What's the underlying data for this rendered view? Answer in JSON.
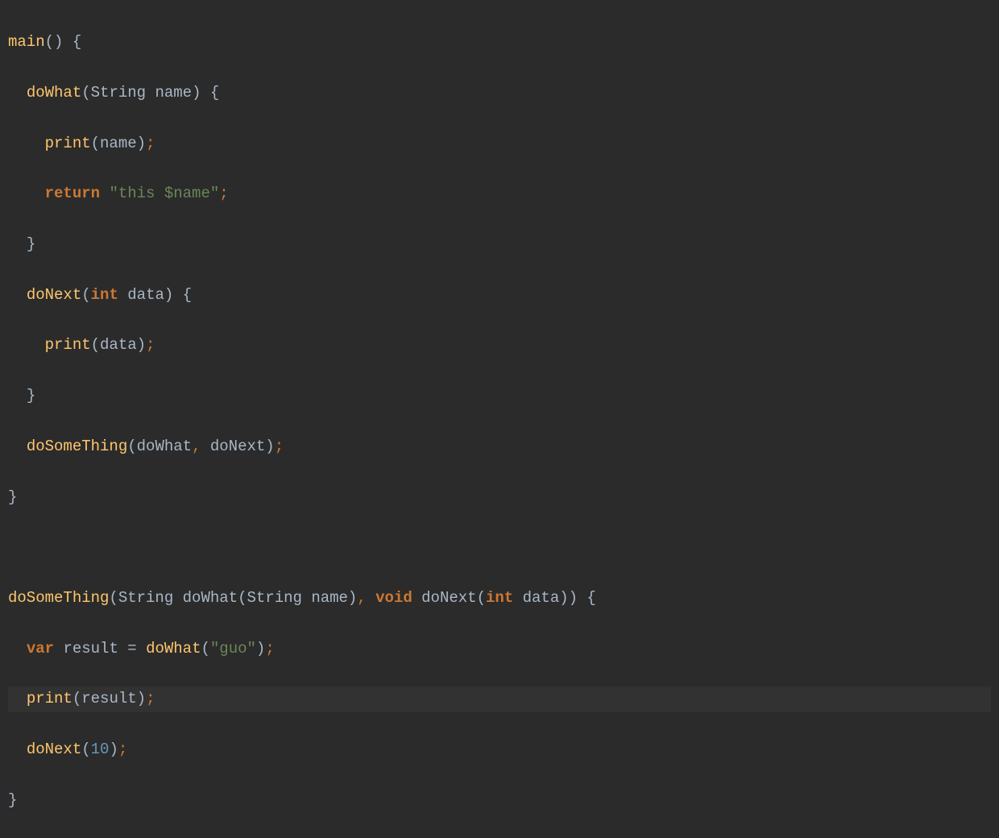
{
  "code": {
    "line1": {
      "fn": "main",
      "parens": "()",
      "brace": " {"
    },
    "line2": {
      "indent": "  ",
      "fn": "doWhat",
      "paren_open": "(",
      "type": "String",
      "space": " ",
      "param": "name",
      "paren_close": ")",
      "brace": " {"
    },
    "line3": {
      "indent": "    ",
      "fn": "print",
      "paren_open": "(",
      "arg": "name",
      "close": ")",
      "semi": ";"
    },
    "line4": {
      "indent": "    ",
      "keyword": "return",
      "space": " ",
      "string": "\"this $name\"",
      "semi": ";"
    },
    "line5": {
      "indent": "  ",
      "brace": "}"
    },
    "line6": {
      "indent": "  ",
      "fn": "doNext",
      "paren_open": "(",
      "type": "int",
      "space": " ",
      "param": "data",
      "paren_close": ")",
      "brace": " {"
    },
    "line7": {
      "indent": "    ",
      "fn": "print",
      "paren_open": "(",
      "arg": "data",
      "close": ")",
      "semi": ";"
    },
    "line8": {
      "indent": "  ",
      "brace": "}"
    },
    "line9": {
      "indent": "  ",
      "fn": "doSomeThing",
      "paren_open": "(",
      "arg1": "doWhat",
      "comma": ",",
      "space": " ",
      "arg2": "doNext",
      "close": ")",
      "semi": ";"
    },
    "line10": {
      "brace": "}"
    },
    "line11": {
      "blank": " "
    },
    "line12": {
      "fn": "doSomeThing",
      "paren_open": "(",
      "type1": "String",
      "space1": " ",
      "inner_fn1": "doWhat",
      "inner_open1": "(",
      "inner_type1": "String",
      "inner_space1": " ",
      "inner_param1": "name",
      "inner_close1": ")",
      "comma": ",",
      "space2": " ",
      "type2": "void",
      "space3": " ",
      "inner_fn2": "doNext",
      "inner_open2": "(",
      "inner_type2": "int",
      "inner_space2": " ",
      "inner_param2": "data",
      "inner_close2": ")",
      "paren_close": ")",
      "brace": " {"
    },
    "line13": {
      "indent": "  ",
      "keyword": "var",
      "space": " ",
      "varname": "result = ",
      "fn": "doWhat",
      "paren_open": "(",
      "string": "\"guo\"",
      "close": ")",
      "semi": ";"
    },
    "line14": {
      "indent": "  ",
      "fn": "print",
      "paren_open": "(",
      "arg": "result",
      "close": ")",
      "semi": ";"
    },
    "line15": {
      "indent": "  ",
      "fn": "doNext",
      "paren_open": "(",
      "number": "10",
      "close": ")",
      "semi": ";"
    },
    "line16": {
      "brace": "}"
    }
  }
}
